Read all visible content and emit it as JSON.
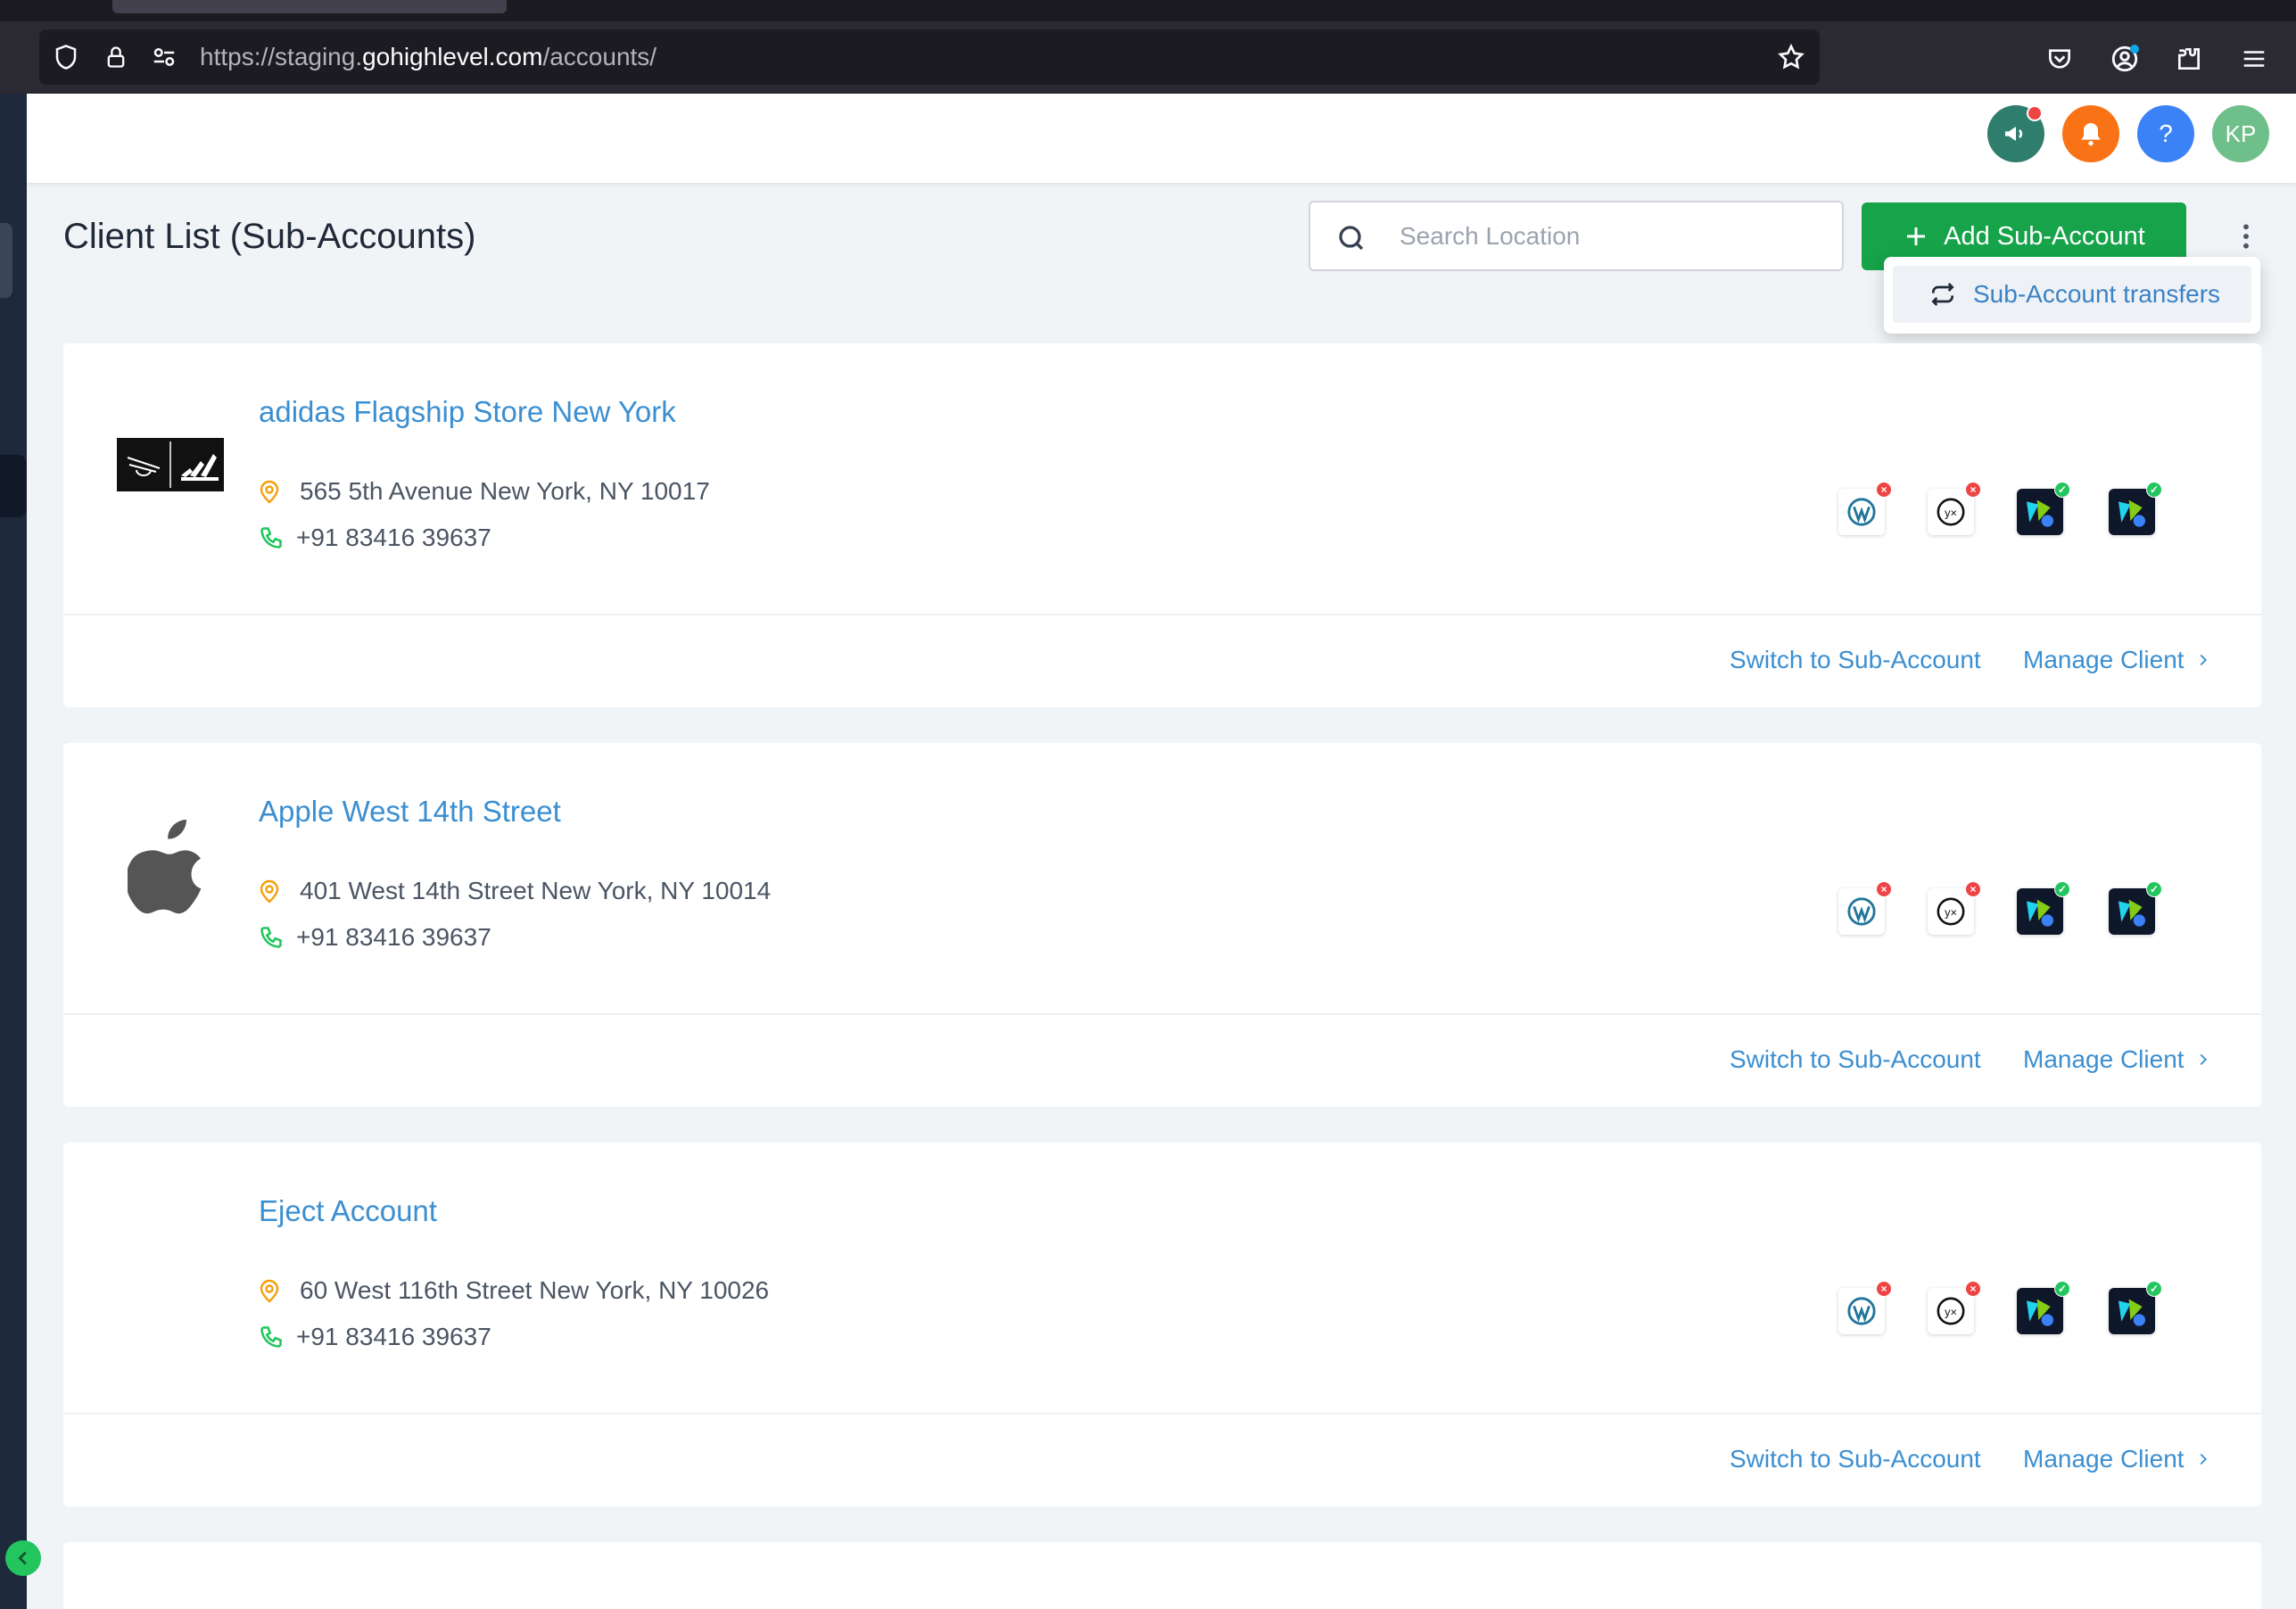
{
  "browser": {
    "url_prefix": "https://staging.",
    "url_host": "gohighlevel.com",
    "url_path": "/accounts/"
  },
  "header": {
    "avatar_initials": "KP",
    "help_label": "?"
  },
  "page": {
    "title": "Client List (Sub-Accounts)",
    "search_placeholder": "Search Location",
    "add_button_label": "Add Sub-Account",
    "dropdown_item": "Sub-Account transfers"
  },
  "accounts": [
    {
      "name": "adidas Flagship Store New York",
      "address": "565 5th Avenue New York, NY 10017",
      "phone": "+91 83416 39637",
      "logo": "adidas-logo"
    },
    {
      "name": "Apple West 14th Street",
      "address": "401 West 14th Street New York, NY 10014",
      "phone": "+91 83416 39637",
      "logo": "apple-logo"
    },
    {
      "name": "Eject Account",
      "address": "60 West 116th Street New York, NY 10026",
      "phone": "+91 83416 39637",
      "logo": ""
    }
  ],
  "card_actions": {
    "switch_label": "Switch to Sub-Account",
    "manage_label": "Manage Client"
  },
  "colors": {
    "accent_blue": "#3b8fd1",
    "primary_green": "#16a34a",
    "notification_orange": "#f97316",
    "help_blue": "#3b82f6",
    "avatar_green": "#6fbf8a",
    "announce_teal": "#2f7d6d"
  }
}
